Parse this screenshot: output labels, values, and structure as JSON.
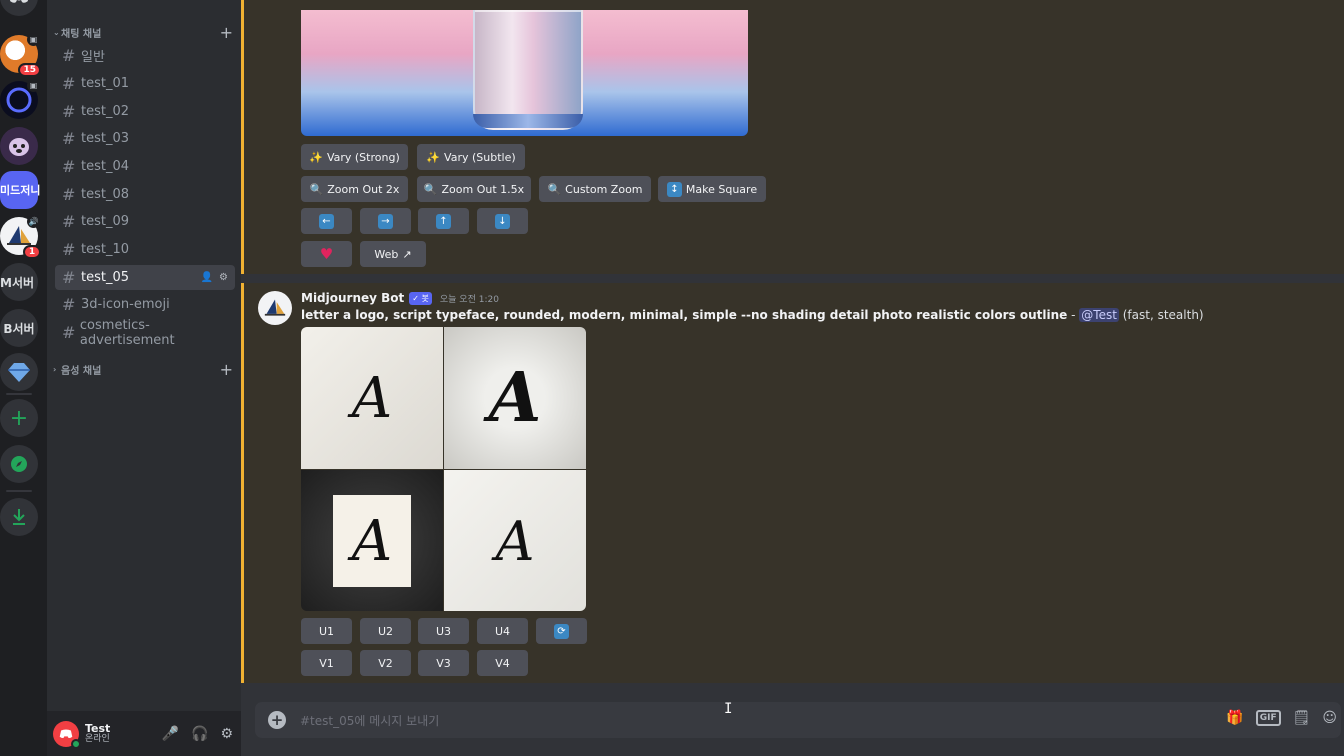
{
  "servers": [
    {
      "name": "corgi-server",
      "badge": "15"
    },
    {
      "name": "ring-server"
    },
    {
      "name": "dog-server"
    },
    {
      "name": "midjourney-server",
      "text": "미드저니"
    },
    {
      "name": "sailboat-server",
      "badge": "1"
    },
    {
      "name": "m-server",
      "text": "M서버"
    },
    {
      "name": "b-server",
      "text": "B서버"
    },
    {
      "name": "diamond-server"
    }
  ],
  "sidebar": {
    "text_category": "채팅 채널",
    "voice_category": "음성 채널",
    "channels": [
      "일반",
      "test_01",
      "test_02",
      "test_03",
      "test_04",
      "test_08",
      "test_09",
      "test_10",
      "test_05",
      "3d-icon-emoji",
      "cosmetics-advertisement"
    ],
    "active_channel": "test_05"
  },
  "user": {
    "name": "Test",
    "status": "온라인"
  },
  "previous_message": {
    "buttons_row1": [
      "Vary (Strong)",
      "Vary (Subtle)"
    ],
    "buttons_row2": [
      "Zoom Out 2x",
      "Zoom Out 1.5x",
      "Custom Zoom",
      "Make Square"
    ],
    "web_label": "Web"
  },
  "message": {
    "author": "Midjourney Bot",
    "tag": "✓ 봇",
    "time": "오늘 오전 1:20",
    "prompt": "letter a logo, script typeface, rounded, modern, minimal, simple --no shading detail photo realistic colors outline",
    "separator": " - ",
    "mention": "@Test",
    "suffix": " (fast, stealth)",
    "grid_letter": "A",
    "upscale_buttons": [
      "U1",
      "U2",
      "U3",
      "U4"
    ],
    "variation_buttons": [
      "V1",
      "V2",
      "V3",
      "V4"
    ]
  },
  "composer": {
    "placeholder": "#test_05에 메시지 보내기"
  },
  "colors": {
    "accent": "#5865f2",
    "highlight_border": "#f0b132",
    "online": "#23a55a",
    "badge": "#f23f43"
  }
}
